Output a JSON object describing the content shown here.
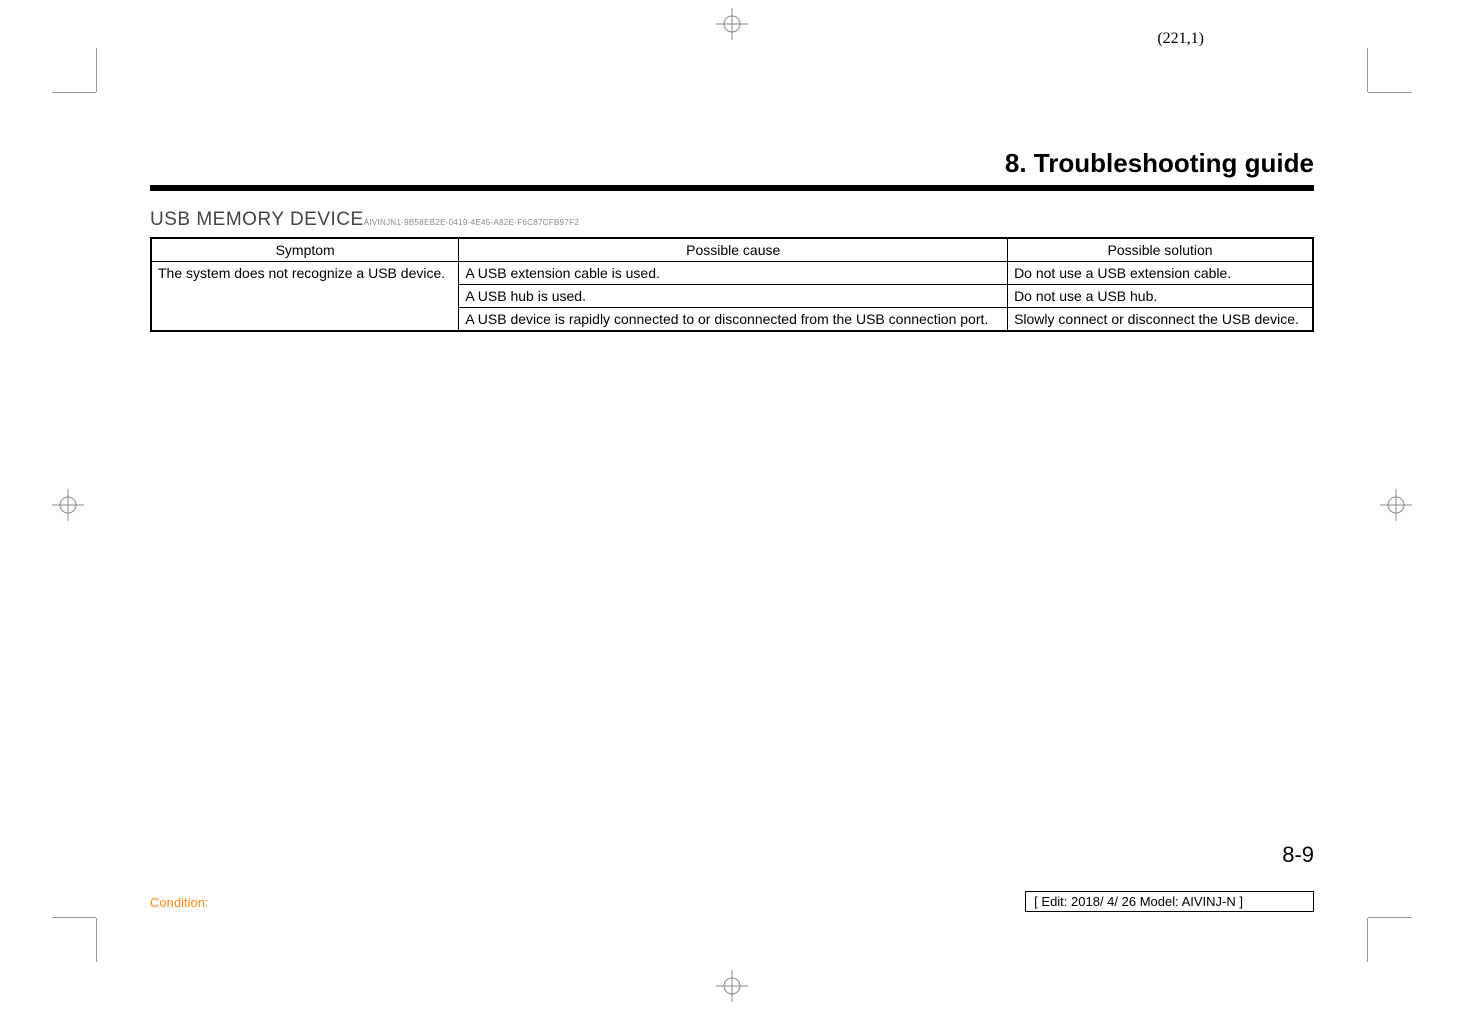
{
  "page_coord": "(221,1)",
  "chapter_title": "8. Troubleshooting guide",
  "section_title": "USB MEMORY DEVICE",
  "section_id": "AIVINJN1-9B58EB2E-0419-4E45-A82E-F6C87CFB97F2",
  "table": {
    "headers": [
      "Symptom",
      "Possible cause",
      "Possible solution"
    ],
    "symptom": "The system does not recognize a USB device.",
    "rows": [
      {
        "cause": "A USB extension cable is used.",
        "solution": "Do not use a USB extension cable."
      },
      {
        "cause": "A USB hub is used.",
        "solution": "Do not use a USB hub."
      },
      {
        "cause": "A USB device is rapidly connected to or disconnected from the USB connection port.",
        "solution": "Slowly connect or disconnect the USB device."
      }
    ]
  },
  "page_number": "8-9",
  "footer_left": "Condition:",
  "footer_right": "[ Edit: 2018/ 4/ 26   Model: AIVINJ-N ]"
}
